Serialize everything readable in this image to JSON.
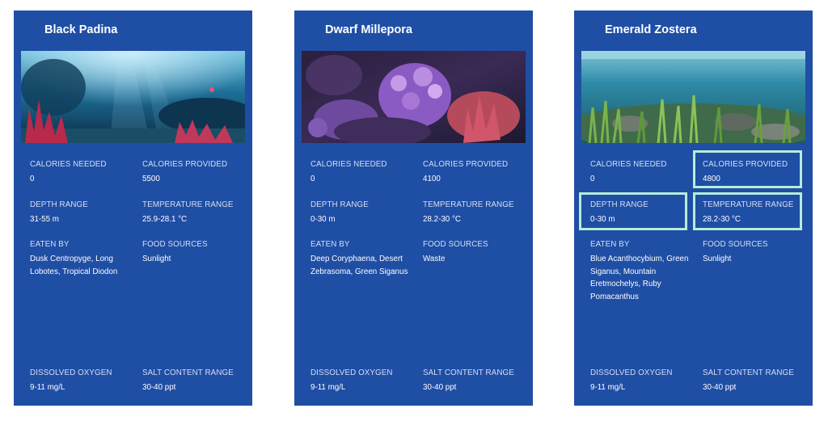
{
  "labels": {
    "calories_needed": "CALORIES NEEDED",
    "calories_provided": "CALORIES PROVIDED",
    "depth_range": "DEPTH RANGE",
    "temperature_range": "TEMPERATURE RANGE",
    "eaten_by": "EATEN BY",
    "food_sources": "FOOD SOURCES",
    "dissolved_oxygen": "DISSOLVED OXYGEN",
    "salt_content_range": "SALT CONTENT RANGE"
  },
  "cards": [
    {
      "title": "Black Padina",
      "calories_needed": "0",
      "calories_provided": "5500",
      "depth_range": "31-55 m",
      "temperature_range": "25.9-28.1 °C",
      "eaten_by": "Dusk Centropyge, Long Lobotes, Tropical Diodon",
      "food_sources": "Sunlight",
      "dissolved_oxygen": "9-11 mg/L",
      "salt_content_range": "30-40 ppt"
    },
    {
      "title": "Dwarf Millepora",
      "calories_needed": "0",
      "calories_provided": "4100",
      "depth_range": "0-30 m",
      "temperature_range": "28.2-30 °C",
      "eaten_by": "Deep Coryphaena, Desert Zebrasoma, Green Siganus",
      "food_sources": "Waste",
      "dissolved_oxygen": "9-11 mg/L",
      "salt_content_range": "30-40 ppt"
    },
    {
      "title": "Emerald Zostera",
      "calories_needed": "0",
      "calories_provided": "4800",
      "depth_range": "0-30 m",
      "temperature_range": "28.2-30 °C",
      "eaten_by": "Blue Acanthocybium, Green Siganus, Mountain Eretmochelys, Ruby Pomacanthus",
      "food_sources": "Sunlight",
      "dissolved_oxygen": "9-11 mg/L",
      "salt_content_range": "30-40 ppt"
    }
  ],
  "colors": {
    "card_background": "#1f4ea5",
    "highlight": "#b7ecd8"
  }
}
